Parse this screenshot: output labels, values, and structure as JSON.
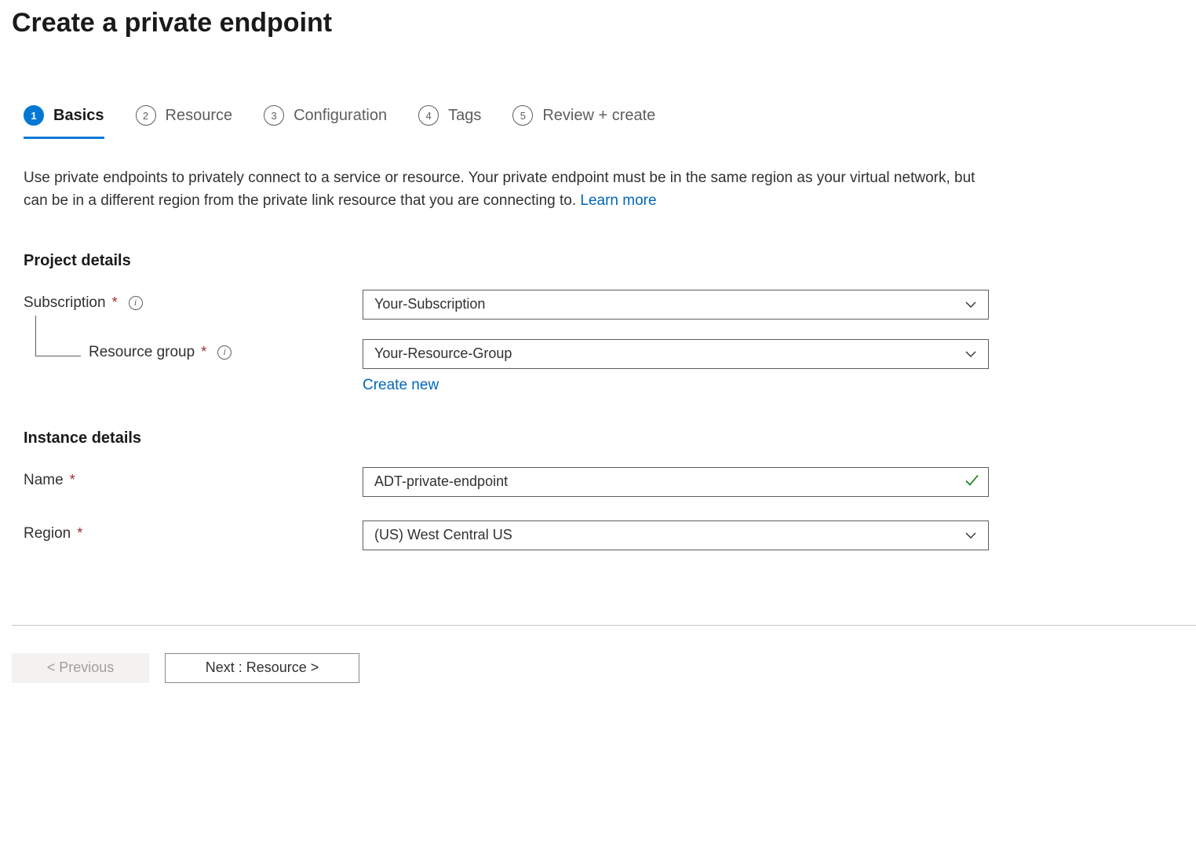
{
  "page_title": "Create a private endpoint",
  "tabs": [
    {
      "number": "1",
      "label": "Basics"
    },
    {
      "number": "2",
      "label": "Resource"
    },
    {
      "number": "3",
      "label": "Configuration"
    },
    {
      "number": "4",
      "label": "Tags"
    },
    {
      "number": "5",
      "label": "Review + create"
    }
  ],
  "description_text": "Use private endpoints to privately connect to a service or resource. Your private endpoint must be in the same region as your virtual network, but can be in a different region from the private link resource that you are connecting to.  ",
  "learn_more_label": "Learn more",
  "sections": {
    "project_details": {
      "heading": "Project details",
      "subscription_label": "Subscription",
      "subscription_value": "Your-Subscription",
      "resource_group_label": "Resource group",
      "resource_group_value": "Your-Resource-Group",
      "create_new_label": "Create new"
    },
    "instance_details": {
      "heading": "Instance details",
      "name_label": "Name",
      "name_value": "ADT-private-endpoint",
      "region_label": "Region",
      "region_value": "(US) West Central US"
    }
  },
  "footer": {
    "previous_label": "< Previous",
    "next_label": "Next : Resource >"
  }
}
